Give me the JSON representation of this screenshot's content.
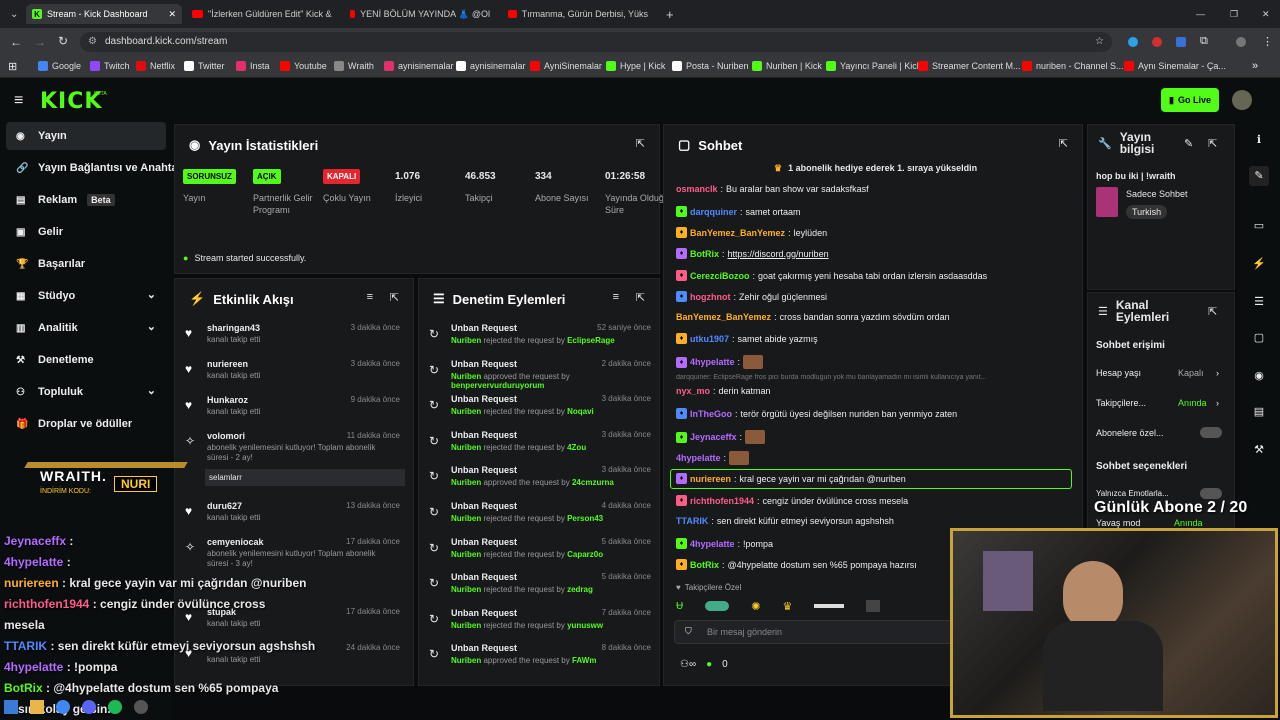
{
  "browser": {
    "tabs": [
      "Stream - Kick Dashboard",
      "\"İzlerken Güldüren Edit\" Kick &",
      "YENİ BÖLÜM YAYINDA 👗 @Ol",
      "Tırmanma, Gürün Derbisi, Yüks"
    ],
    "url": "dashboard.kick.com/stream",
    "bookmarks": [
      "Google",
      "Twitch",
      "Netflix",
      "Twitter",
      "Insta",
      "Youtube",
      "Wraith",
      "aynisinemalar",
      "aynisinemalar",
      "AyniSinemalar",
      "Hype | Kick",
      "Posta - Nuriben",
      "Nuriben | Kick",
      "Yayıncı Paneli | Kick",
      "Streamer Content M...",
      "nuriben - Channel S...",
      "Aynı Sinemalar - Ça..."
    ]
  },
  "header": {
    "logo": "KICK",
    "beta": "BETA",
    "go_live": "Go Live"
  },
  "sidebar": {
    "items": [
      {
        "label": "Yayın",
        "icon": "broadcast-icon"
      },
      {
        "label": "Yayın Bağlantısı ve Anahtar",
        "icon": "link-icon"
      },
      {
        "label": "Reklam",
        "badge": "Beta",
        "icon": "ad-icon"
      },
      {
        "label": "Gelir",
        "icon": "wallet-icon"
      },
      {
        "label": "Başarılar",
        "icon": "trophy-icon"
      },
      {
        "label": "Stüdyo",
        "icon": "studio-icon"
      },
      {
        "label": "Analitik",
        "icon": "chart-icon"
      },
      {
        "label": "Denetleme",
        "icon": "hammer-icon"
      },
      {
        "label": "Topluluk",
        "icon": "people-icon"
      },
      {
        "label": "Droplar ve ödüller",
        "icon": "gift-icon"
      }
    ]
  },
  "stats": {
    "title": "Yayın İstatistikleri",
    "badges": [
      {
        "text": "SORUNSUZ",
        "label": "Yayın"
      },
      {
        "text": "AÇIK",
        "label": "Partnerlik Gelir Programı"
      },
      {
        "text": "KAPALI",
        "label": "Çoklu Yayın"
      }
    ],
    "values": [
      {
        "v": "1.076",
        "l": "İzleyici"
      },
      {
        "v": "46.853",
        "l": "Takipçi"
      },
      {
        "v": "334",
        "l": "Abone Sayısı"
      },
      {
        "v": "01:26:58",
        "l": "Yayında Olduğu Süre"
      }
    ],
    "status": "Stream started successfully."
  },
  "activity": {
    "title": "Etkinlik Akışı",
    "items": [
      {
        "n": "sharingan43",
        "s": "kanalı takip etti",
        "t": "3 dakika önce"
      },
      {
        "n": "nuriereen",
        "s": "kanalı takip etti",
        "t": "3 dakika önce"
      },
      {
        "n": "Hunkaroz",
        "s": "kanalı takip etti",
        "t": "9 dakika önce"
      },
      {
        "n": "volomori",
        "s": "abonelik yenilemesini kutluyor! Toplam abonelik süresi - 2 ay!",
        "t": "11 dakika önce",
        "msg": "selamlarr"
      },
      {
        "n": "duru627",
        "s": "kanalı takip etti",
        "t": "13 dakika önce"
      },
      {
        "n": "cemyeniocak",
        "s": "abonelik yenilemesini kutluyor! Toplam abonelik süresi - 3 ay!",
        "t": "17 dakika önce"
      },
      {
        "n": "stupak",
        "s": "kanalı takip etti",
        "t": "17 dakika önce"
      },
      {
        "n": "",
        "s": "kanalı takip etti",
        "t": "24 dakika önce"
      }
    ]
  },
  "moderation": {
    "title": "Denetim Eylemleri",
    "items": [
      {
        "n": "Unban Request",
        "by": "Nuriben",
        "act": "rejected the request by",
        "u": "EclipseRage",
        "t": "52 saniye önce"
      },
      {
        "n": "Unban Request",
        "by": "Nuriben",
        "act": "approved the request by",
        "u": "benpervervurduruyorum",
        "t": "2 dakika önce"
      },
      {
        "n": "Unban Request",
        "by": "Nuriben",
        "act": "rejected the request by",
        "u": "Noqavi",
        "t": "3 dakika önce"
      },
      {
        "n": "Unban Request",
        "by": "Nuriben",
        "act": "rejected the request by",
        "u": "4Zou",
        "t": "3 dakika önce"
      },
      {
        "n": "Unban Request",
        "by": "Nuriben",
        "act": "approved the request by",
        "u": "24cmzurna",
        "t": "3 dakika önce"
      },
      {
        "n": "Unban Request",
        "by": "Nuriben",
        "act": "rejected the request by",
        "u": "Person43",
        "t": "4 dakika önce"
      },
      {
        "n": "Unban Request",
        "by": "Nuriben",
        "act": "rejected the request by",
        "u": "Caparz0o",
        "t": "5 dakika önce"
      },
      {
        "n": "Unban Request",
        "by": "Nuriben",
        "act": "rejected the request by",
        "u": "zedrag",
        "t": "5 dakika önce"
      },
      {
        "n": "Unban Request",
        "by": "Nuriben",
        "act": "rejected the request by",
        "u": "yunusww",
        "t": "7 dakika önce"
      },
      {
        "n": "Unban Request",
        "by": "Nuriben",
        "act": "approved the request by",
        "u": "FAWm",
        "t": "8 dakika önce"
      }
    ]
  },
  "chat": {
    "title": "Sohbet",
    "pinned": "1 abonelik hediye ederek 1. sıraya yükseldin",
    "messages": [
      {
        "u": "osmanclk",
        "c": "#ff5c8a",
        "m": "Bu aralar ban show var sadaksfkasf"
      },
      {
        "u": "darqquiner",
        "c": "#4d8bff",
        "m": "samet ortaam"
      },
      {
        "u": "BanYemez_BanYemez",
        "c": "#ffb020",
        "m": "leylüden"
      },
      {
        "u": "BotRix",
        "c": "#53fc18",
        "m": "https://discord.gg/nuriben"
      },
      {
        "u": "CerezciBozoo",
        "c": "#53fc18",
        "m": "goat çakırmış yeni hesaba tabi ordan izlersin asdaasddas"
      },
      {
        "u": "hogzhnot",
        "c": "#ff5c8a",
        "m": "Zehir oğul güçlenmesi"
      },
      {
        "u": "BanYemez_BanYemez",
        "c": "#ffb020",
        "m": "cross bandan sonra yazdım sövdüm ordan"
      },
      {
        "u": "utku1907",
        "c": "#4d8bff",
        "m": "samet abide yazmış"
      },
      {
        "u": "4hypelatte",
        "c": "#b46bff",
        "m": ""
      },
      {
        "u": "nyx_mo",
        "c": "#ff5c8a",
        "m": "derin katman"
      },
      {
        "u": "InTheGoo",
        "c": "#b46bff",
        "m": "terör örgütü üyesi değilsen nuriden ban yenmiyo zaten"
      },
      {
        "u": "Jeynaceffx",
        "c": "#b46bff",
        "m": ""
      },
      {
        "u": "4hypelatte",
        "c": "#b46bff",
        "m": ""
      },
      {
        "u": "nuriereen",
        "c": "#ffb020",
        "m": "kral gece yayin var mi çağrıdan @nuriben"
      },
      {
        "u": "richthofen1944",
        "c": "#ff5c8a",
        "m": "cengiz ünder övülünce cross mesela"
      },
      {
        "u": "TTARIK",
        "c": "#4d8bff",
        "m": "sen direkt küfür etmeyi seviyorsun agshshsh"
      },
      {
        "u": "4hypelatte",
        "c": "#b46bff",
        "m": "!pompa"
      },
      {
        "u": "BotRix",
        "c": "#53fc18",
        "m": "@4hypelatte dostum sen %65 pompaya hazırsı"
      }
    ],
    "reply": "darqquiner: EclipseRage fros pici burda modlugun yok mu banlayamadın mi isimli kullanıcıya yanıt...",
    "followers": "Takipçilere Özel",
    "placeholder": "Bir mesaj gönderin",
    "count": "0"
  },
  "info": {
    "title": "Yayın bilgisi",
    "stream_title": "hop bu iki | !wraith",
    "category": "Sadece Sohbet",
    "lang": "Turkish"
  },
  "channel": {
    "title": "Kanal Eylemleri",
    "chat_access": "Sohbet erişimi",
    "rows": [
      {
        "l": "Hesap yaşı",
        "v": "Kapalı"
      },
      {
        "l": "Takipçilere...",
        "v": "Anında"
      },
      {
        "l": "Abonelere özel...",
        "v": ""
      }
    ],
    "chat_opts": "Sohbet seçenekleri",
    "emote": "Yalnızca Emotlarla...",
    "slow": "Yavaş mod",
    "slow_v": "Anında"
  },
  "overlay": {
    "sub_goal": "Günlük Abone 2 / 20",
    "promo1": "WRAITH.",
    "promo2": "İNDİRİM KODU:",
    "promo3": "NURI",
    "chat": [
      {
        "u": "Jeynaceffx",
        "c": "#b46bff",
        "m": ":"
      },
      {
        "u": "4hypelatte",
        "c": "#b46bff",
        "m": ":"
      },
      {
        "u": "nuriereen",
        "c": "#ffb020",
        "m": ": kral gece yayin var mi çağrıdan @nuriben"
      },
      {
        "u": "richthofen1944",
        "c": "#ff5c8a",
        "m": ": cengiz ünder övülünce cross"
      },
      {
        "u": "",
        "c": "#fff",
        "m": "mesela"
      },
      {
        "u": "TTARIK",
        "c": "#4d8bff",
        "m": ": sen direkt küfür etmeyi seviyorsun agshshsh"
      },
      {
        "u": "4hypelatte",
        "c": "#b46bff",
        "m": ": !pompa"
      },
      {
        "u": "BotRix",
        "c": "#53fc18",
        "m": ": @4hypelatte dostum sen %65 pompaya"
      },
      {
        "u": "",
        "c": "#fff",
        "m": "zırsın kolay gelsin."
      }
    ]
  }
}
